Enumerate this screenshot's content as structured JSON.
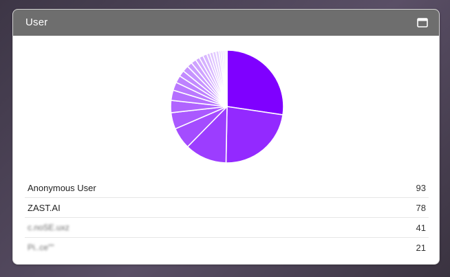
{
  "panel": {
    "title": "User",
    "maximize_icon": "window-maximize-icon"
  },
  "chart_data": {
    "type": "pie",
    "colors": {
      "accent": "#7f00ff",
      "light": "#efe6ff"
    },
    "values": [
      93,
      78,
      41,
      21,
      16,
      12,
      10,
      8,
      7,
      6,
      6,
      5,
      5,
      4,
      4,
      4,
      3,
      3,
      3,
      3,
      2,
      2,
      2,
      2
    ],
    "labels": [
      "Anonymous User",
      "ZAST.AI",
      "c.noSE.uxz",
      "Pi..ce\"\""
    ]
  },
  "rows": [
    {
      "name": "Anonymous User",
      "value": "93",
      "redacted": false
    },
    {
      "name": "ZAST.AI",
      "value": "78",
      "redacted": false
    },
    {
      "name": "c.noSE.uxz",
      "value": "41",
      "redacted": true
    },
    {
      "name": "Pi..ce\"\"",
      "value": "21",
      "redacted": true
    }
  ]
}
